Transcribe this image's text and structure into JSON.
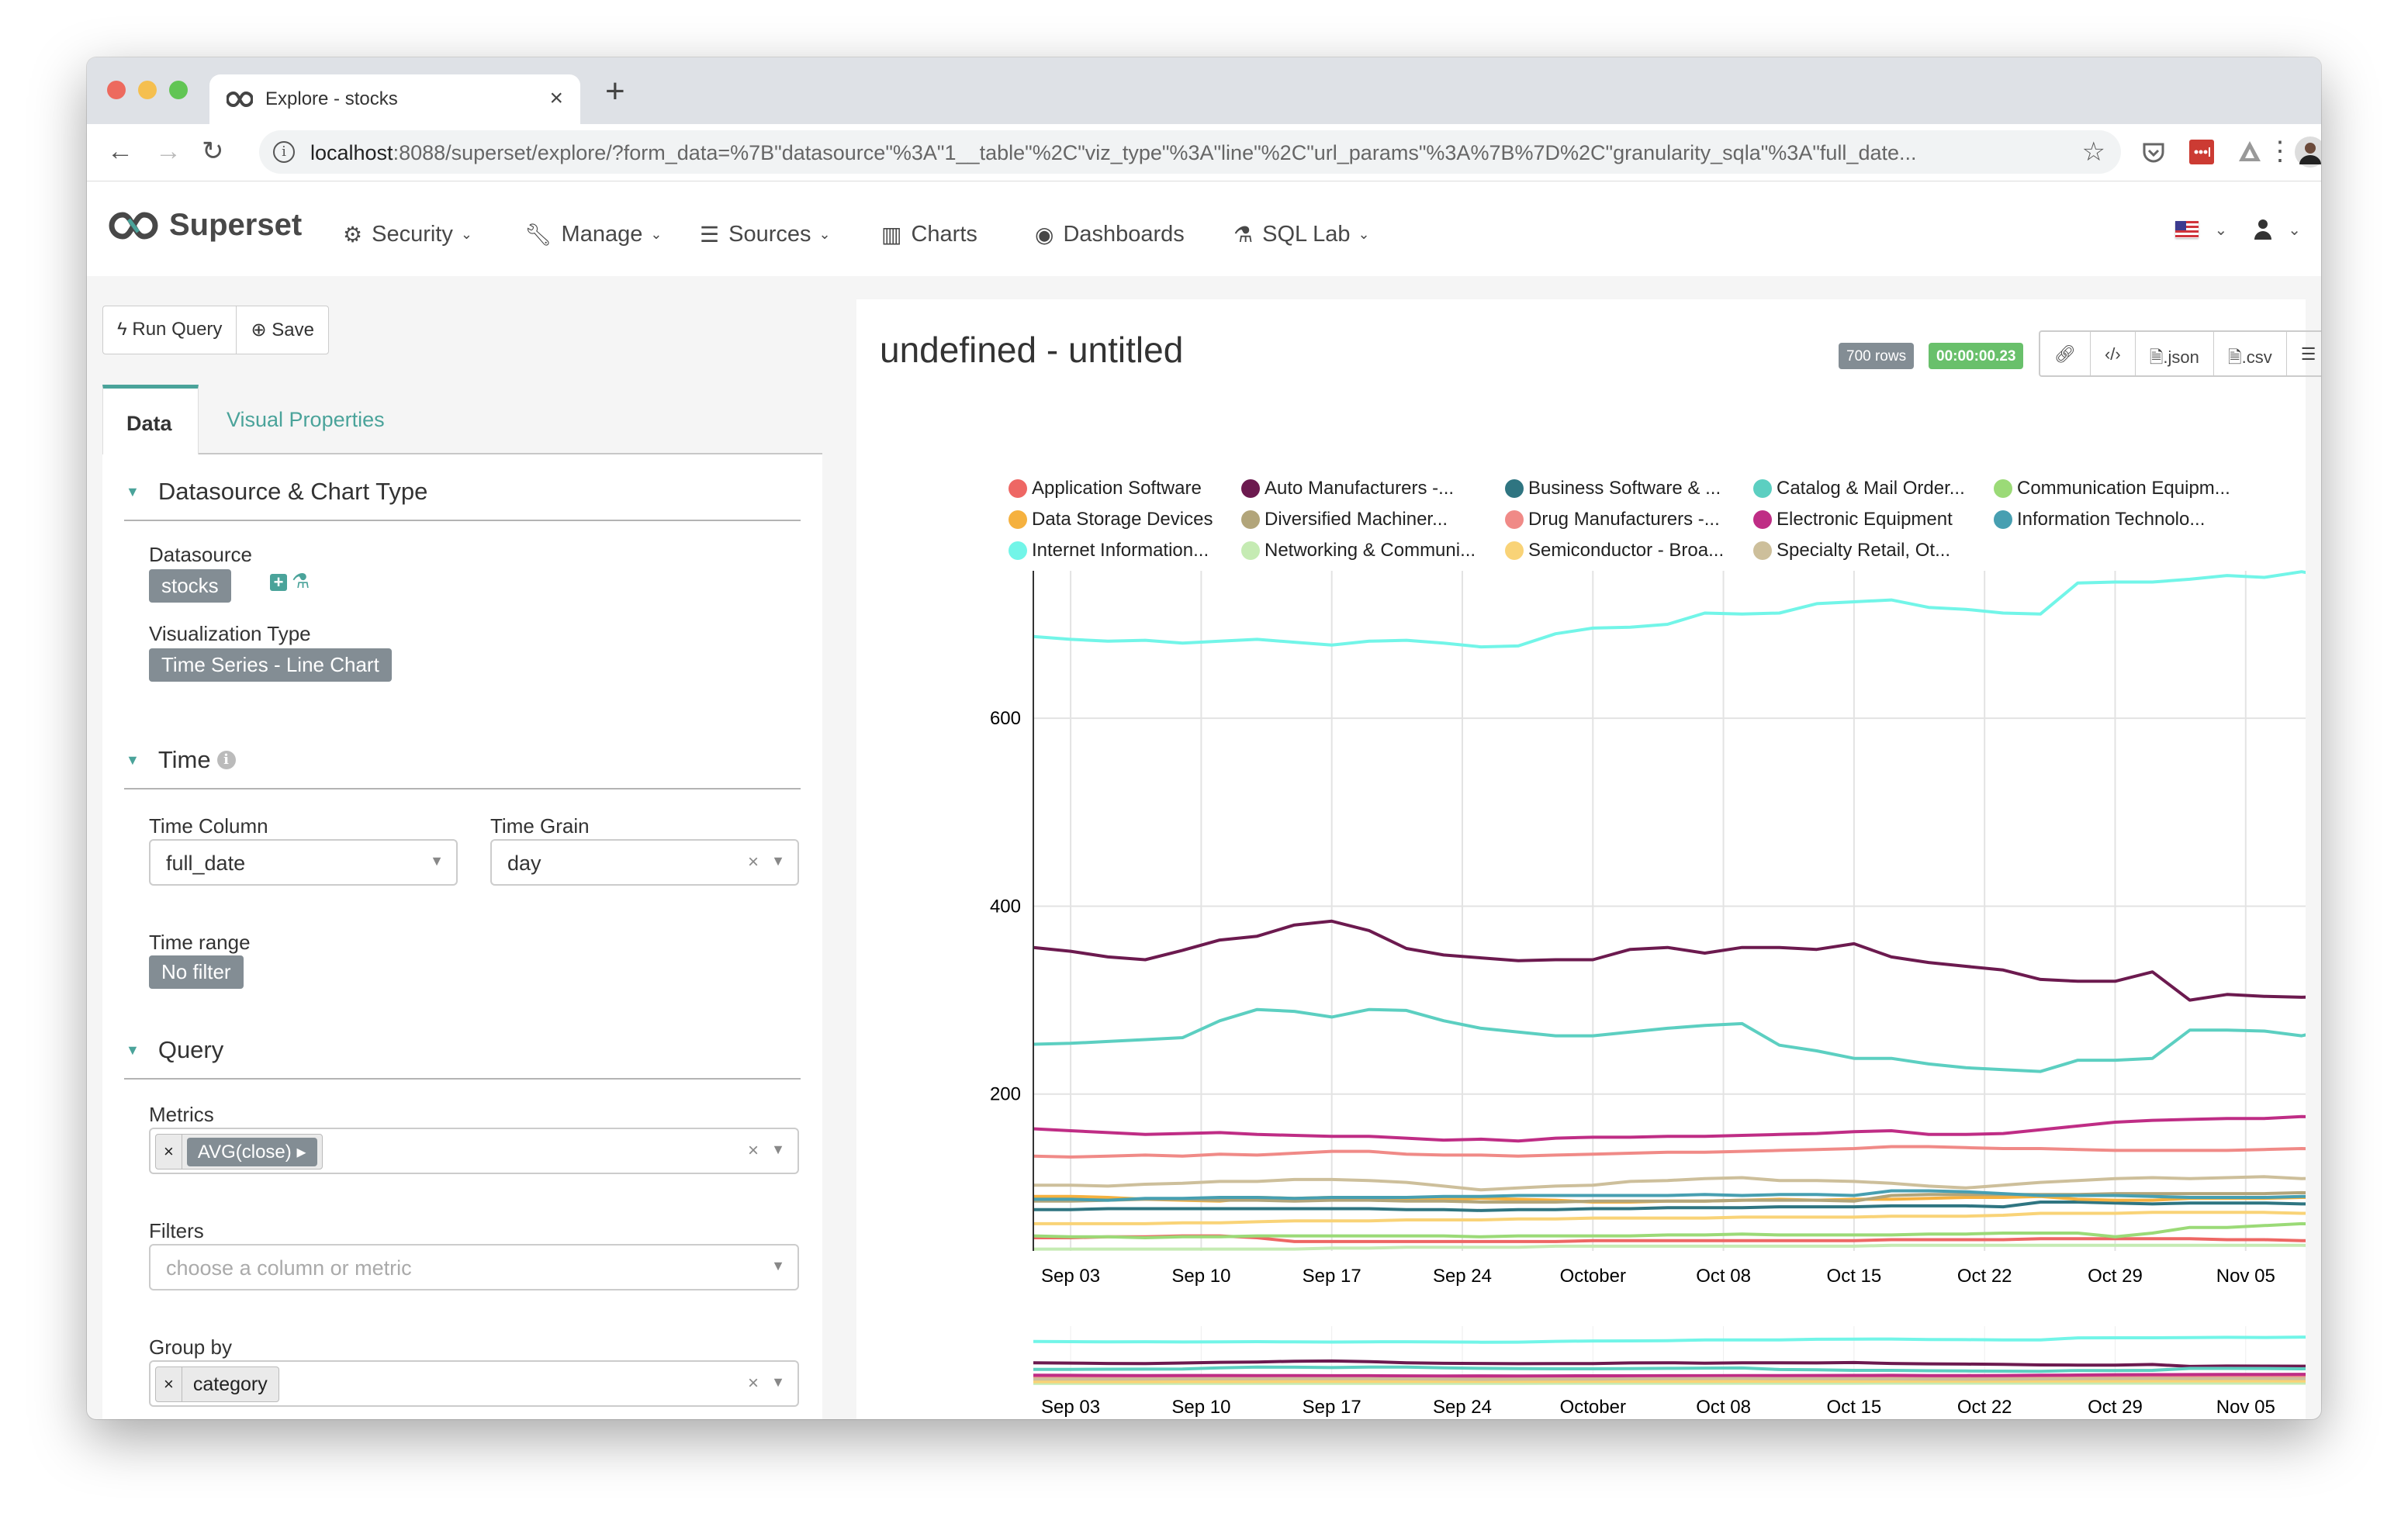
{
  "browser": {
    "tab_title": "Explore - stocks",
    "new_tab": "+",
    "close": "×",
    "url_host": "localhost",
    "url_rest": ":8088/superset/explore/?form_data=%7B\"datasource\"%3A\"1__table\"%2C\"viz_type\"%3A\"line\"%2C\"url_params\"%3A%7B%7D%2C\"granularity_sqla\"%3A\"full_date..."
  },
  "navbar": {
    "brand": "Superset",
    "items": [
      {
        "label": "Security",
        "icon": "gears-icon",
        "dropdown": true
      },
      {
        "label": "Manage",
        "icon": "wrench-icon",
        "dropdown": true
      },
      {
        "label": "Sources",
        "icon": "database-icon",
        "dropdown": true
      },
      {
        "label": "Charts",
        "icon": "bar-chart-icon",
        "dropdown": false
      },
      {
        "label": "Dashboards",
        "icon": "dashboard-icon",
        "dropdown": false
      },
      {
        "label": "SQL Lab",
        "icon": "flask-icon",
        "dropdown": true
      }
    ]
  },
  "left": {
    "run_query": "Run Query",
    "save": "Save",
    "tabs": [
      "Data",
      "Visual Properties"
    ],
    "sections": {
      "datasource": {
        "title": "Datasource & Chart Type",
        "datasource_label": "Datasource",
        "datasource_value": "stocks",
        "viz_label": "Visualization Type",
        "viz_value": "Time Series - Line Chart"
      },
      "time": {
        "title": "Time",
        "time_column_label": "Time Column",
        "time_column_value": "full_date",
        "time_grain_label": "Time Grain",
        "time_grain_value": "day",
        "time_range_label": "Time range",
        "time_range_value": "No filter"
      },
      "query": {
        "title": "Query",
        "metrics_label": "Metrics",
        "metric_value": "AVG(close)",
        "filters_label": "Filters",
        "filters_placeholder": "choose a column or metric",
        "groupby_label": "Group by",
        "groupby_value": "category"
      }
    }
  },
  "chart_panel": {
    "title": "undefined - untitled",
    "rows_badge": "700 rows",
    "time_badge": "00:00:00.23",
    "buttons": [
      ".json",
      ".csv"
    ]
  },
  "chart_data": {
    "type": "line",
    "title": "undefined - untitled",
    "xlabel": "",
    "ylabel": "",
    "ylim": [
      33,
      757
    ],
    "yticks": [
      200,
      400,
      600
    ],
    "xticks": [
      "Sep 03",
      "Sep 10",
      "Sep 17",
      "Sep 24",
      "October",
      "Oct 08",
      "Oct 15",
      "Oct 22",
      "Oct 29",
      "Nov 05"
    ],
    "xtick_days": [
      2,
      9,
      16,
      23,
      30,
      37,
      44,
      51,
      58,
      65
    ],
    "x_day_range": [
      0,
      70
    ],
    "grid": true,
    "legend": "top",
    "x": [
      "Sep 01",
      "Sep 03",
      "Sep 05",
      "Sep 07",
      "Sep 09",
      "Sep 11",
      "Sep 13",
      "Sep 15",
      "Sep 17",
      "Sep 19",
      "Sep 21",
      "Sep 23",
      "Sep 25",
      "Sep 27",
      "Sep 29",
      "Oct 01",
      "Oct 03",
      "Oct 05",
      "Oct 07",
      "Oct 09",
      "Oct 11",
      "Oct 13",
      "Oct 15",
      "Oct 17",
      "Oct 19",
      "Oct 21",
      "Oct 23",
      "Oct 25",
      "Oct 27",
      "Oct 29",
      "Oct 31",
      "Nov 02",
      "Nov 04",
      "Nov 06",
      "Nov 08",
      "Nov 10"
    ],
    "x_days": [
      0,
      2,
      4,
      6,
      8,
      10,
      12,
      14,
      16,
      18,
      20,
      22,
      24,
      26,
      28,
      30,
      32,
      34,
      36,
      38,
      40,
      42,
      44,
      46,
      48,
      50,
      52,
      54,
      56,
      58,
      60,
      62,
      64,
      66,
      68,
      70
    ],
    "series": [
      {
        "name": "Application Software",
        "color": "#ee6764",
        "values": [
          47,
          47,
          48,
          48,
          49,
          49,
          47,
          43,
          43,
          43,
          43,
          43,
          43,
          43,
          43,
          44,
          44,
          44,
          44,
          44,
          44,
          44,
          44,
          45,
          45,
          45,
          45,
          46,
          46,
          46,
          46,
          46,
          45,
          45,
          44,
          44
        ]
      },
      {
        "name": "Auto Manufacturers -...",
        "color": "#6c1a4f",
        "values": [
          356,
          352,
          346,
          343,
          353,
          364,
          368,
          380,
          384,
          374,
          355,
          348,
          345,
          342,
          343,
          343,
          354,
          356,
          350,
          356,
          356,
          354,
          360,
          346,
          340,
          336,
          332,
          322,
          320,
          320,
          330,
          300,
          306,
          304,
          303,
          304
        ]
      },
      {
        "name": "Business Software & ...",
        "color": "#2f7581",
        "values": [
          77,
          77,
          78,
          78,
          78,
          78,
          78,
          78,
          78,
          78,
          77,
          77,
          76,
          77,
          77,
          78,
          78,
          79,
          79,
          79,
          80,
          80,
          80,
          81,
          81,
          81,
          80,
          85,
          85,
          84,
          83,
          84,
          84,
          84,
          83,
          83
        ]
      },
      {
        "name": "Catalog & Mail Order...",
        "color": "#5ccfc1",
        "values": [
          253,
          254,
          256,
          258,
          260,
          278,
          290,
          288,
          282,
          290,
          289,
          278,
          270,
          266,
          262,
          262,
          266,
          270,
          273,
          275,
          252,
          246,
          238,
          238,
          232,
          228,
          226,
          224,
          236,
          236,
          238,
          268,
          268,
          267,
          262,
          271
        ]
      },
      {
        "name": "Communication Equipm...",
        "color": "#9bda77",
        "values": [
          49,
          48,
          48,
          47,
          48,
          48,
          49,
          49,
          49,
          49,
          49,
          49,
          48,
          49,
          49,
          49,
          49,
          50,
          50,
          51,
          50,
          50,
          50,
          50,
          51,
          51,
          52,
          52,
          52,
          48,
          52,
          58,
          58,
          60,
          62,
          61
        ]
      },
      {
        "name": "Data Storage Devices",
        "color": "#f5b13f",
        "values": [
          91,
          91,
          90,
          88,
          87,
          86,
          90,
          89,
          90,
          88,
          87,
          88,
          89,
          88,
          87,
          85,
          85,
          86,
          86,
          87,
          88,
          87,
          88,
          88,
          89,
          90,
          90,
          91,
          88,
          87,
          87,
          89,
          89,
          89,
          90,
          90
        ]
      },
      {
        "name": "Diversified Machiner...",
        "color": "#b2a57a",
        "values": [
          86,
          86,
          87,
          88,
          88,
          87,
          87,
          86,
          87,
          87,
          86,
          86,
          85,
          85,
          85,
          86,
          86,
          86,
          86,
          87,
          87,
          87,
          86,
          92,
          93,
          93,
          93,
          93,
          93,
          94,
          94,
          94,
          94,
          94,
          95,
          94
        ]
      },
      {
        "name": "Drug Manufacturers -...",
        "color": "#f08a87",
        "values": [
          134,
          133,
          134,
          135,
          134,
          136,
          135,
          137,
          139,
          139,
          136,
          135,
          135,
          134,
          135,
          136,
          137,
          138,
          138,
          139,
          140,
          141,
          142,
          144,
          144,
          143,
          142,
          142,
          141,
          140,
          140,
          140,
          140,
          141,
          142,
          141
        ]
      },
      {
        "name": "Electronic Equipment",
        "color": "#bf2d85",
        "values": [
          163,
          161,
          159,
          157,
          158,
          159,
          157,
          156,
          155,
          155,
          153,
          151,
          152,
          150,
          153,
          154,
          154,
          155,
          155,
          156,
          157,
          158,
          160,
          161,
          157,
          157,
          158,
          162,
          166,
          170,
          172,
          173,
          174,
          174,
          176,
          175
        ]
      },
      {
        "name": "Information Technolo...",
        "color": "#479fb1",
        "values": [
          88,
          88,
          87,
          89,
          89,
          90,
          90,
          89,
          90,
          90,
          90,
          91,
          91,
          92,
          92,
          92,
          92,
          92,
          93,
          92,
          93,
          93,
          92,
          97,
          97,
          96,
          94,
          92,
          92,
          92,
          91,
          90,
          90,
          90,
          91,
          91
        ]
      },
      {
        "name": "Internet Information...",
        "color": "#72f5e8",
        "values": [
          687,
          684,
          682,
          683,
          680,
          682,
          684,
          681,
          678,
          682,
          683,
          680,
          676,
          677,
          690,
          696,
          697,
          700,
          712,
          711,
          712,
          722,
          724,
          726,
          718,
          716,
          712,
          711,
          744,
          745,
          745,
          748,
          752,
          750,
          756,
          749
        ]
      },
      {
        "name": "Networking & Communi...",
        "color": "#c5ebb3",
        "values": [
          35,
          35,
          35,
          35,
          35,
          35,
          35,
          35,
          36,
          36,
          37,
          37,
          37,
          37,
          38,
          38,
          38,
          38,
          38,
          38,
          38,
          38,
          38,
          39,
          39,
          39,
          39,
          39,
          39,
          39,
          39,
          39,
          39,
          39,
          39,
          38
        ]
      },
      {
        "name": "Semiconductor - Broa...",
        "color": "#f9d377",
        "values": [
          62,
          62,
          62,
          62,
          63,
          63,
          64,
          65,
          65,
          65,
          66,
          66,
          66,
          67,
          67,
          68,
          68,
          68,
          68,
          69,
          69,
          69,
          69,
          70,
          70,
          70,
          71,
          73,
          73,
          73,
          74,
          74,
          74,
          74,
          73,
          73
        ]
      },
      {
        "name": "Specialty Retail, Ot...",
        "color": "#cdbf9b",
        "values": [
          103,
          103,
          102,
          104,
          105,
          107,
          107,
          109,
          109,
          108,
          106,
          102,
          98,
          100,
          102,
          103,
          107,
          108,
          110,
          111,
          108,
          108,
          107,
          105,
          102,
          100,
          103,
          106,
          108,
          110,
          111,
          110,
          111,
          112,
          110,
          111
        ]
      }
    ],
    "legend_order": [
      "Application Software",
      "Auto Manufacturers -...",
      "Business Software & ...",
      "Catalog & Mail Order...",
      "Communication Equipm...",
      "Data Storage Devices",
      "Diversified Machiner...",
      "Drug Manufacturers -...",
      "Electronic Equipment",
      "Information Technolo...",
      "Internet Information...",
      "Networking & Communi...",
      "Semiconductor - Broa...",
      "Specialty Retail, Ot..."
    ]
  },
  "colors": {
    "accent": "#4aa39a",
    "tag_gray": "#838d94",
    "success": "#69c06b"
  }
}
